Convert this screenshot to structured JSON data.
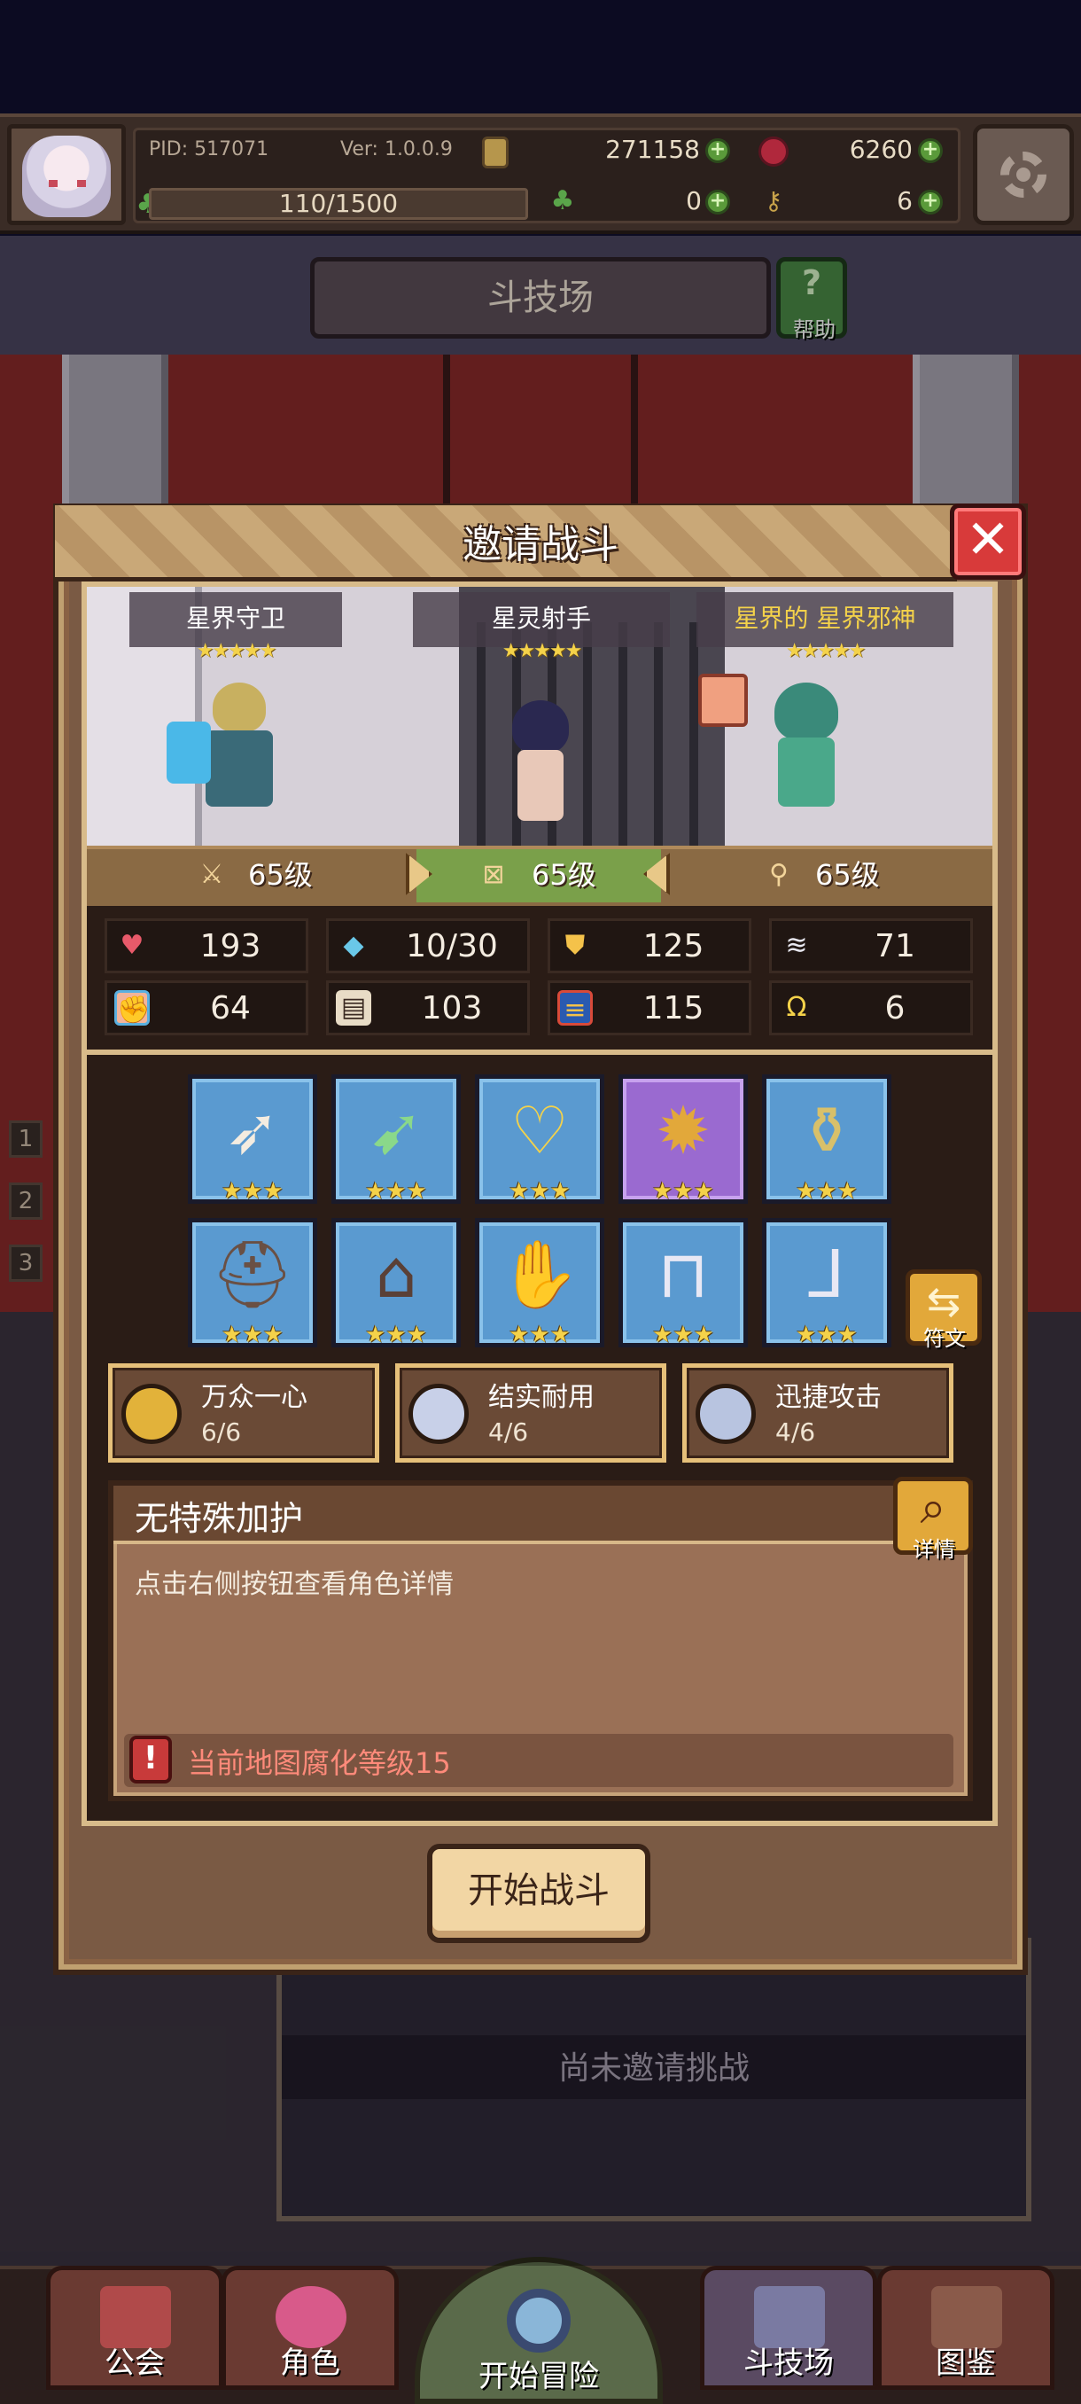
{
  "header": {
    "pid": "PID: 517071",
    "version": "Ver: 1.0.0.9",
    "gold": "271158",
    "gems": "6260",
    "energy": "110/1500",
    "clovers": "0",
    "keys": "6",
    "energy_fraction": 0.0733
  },
  "arena": {
    "title": "斗技场",
    "help_label": "帮助",
    "side_numbers": [
      "1",
      "2",
      "3"
    ],
    "challenge_status": "尚未邀请挑战"
  },
  "modal": {
    "title": "邀请战斗",
    "close_glyph": "✕",
    "heroes": [
      {
        "name": "星界守卫",
        "stars": "★★★★★",
        "level": "65级"
      },
      {
        "name": "星灵射手",
        "stars": "★★★★★",
        "level": "65级"
      },
      {
        "name": "星界的 星界邪神",
        "stars": "★★★★★",
        "level": "65级"
      }
    ],
    "stats": [
      {
        "icon": "heart-icon",
        "glyph": "♥",
        "value": "193",
        "color": "#e85a6a"
      },
      {
        "icon": "mana-drop-icon",
        "glyph": "💧",
        "value": "10/30",
        "color": "#6ac8e8"
      },
      {
        "icon": "shield-icon",
        "glyph": "⛊",
        "value": "125",
        "color": "#f4c24a"
      },
      {
        "icon": "wing-icon",
        "glyph": "≋",
        "value": "71",
        "color": "#e8e8f0"
      },
      {
        "icon": "fist-icon",
        "glyph": "✊",
        "value": "64",
        "color": "#f2b49a"
      },
      {
        "icon": "book-icon",
        "glyph": "▤",
        "value": "103",
        "color": "#e8dcc6"
      },
      {
        "icon": "scroll-icon",
        "glyph": "≡",
        "value": "115",
        "color": "#f4c24a"
      },
      {
        "icon": "horseshoe-icon",
        "glyph": "Ω",
        "value": "6",
        "color": "#f4d24a"
      }
    ],
    "equipment": [
      {
        "name": "bow-icon",
        "glyph": "➶",
        "stars": "★★★",
        "rarity": "blue"
      },
      {
        "name": "arrow-icon",
        "glyph": "➹",
        "stars": "★★★",
        "rarity": "blue"
      },
      {
        "name": "necklace-icon",
        "glyph": "♡",
        "stars": "★★★",
        "rarity": "blue"
      },
      {
        "name": "amulet-icon",
        "glyph": "✹",
        "stars": "★★★",
        "rarity": "purple"
      },
      {
        "name": "ring-icon",
        "glyph": "⚱",
        "stars": "★★★",
        "rarity": "blue"
      },
      {
        "name": "hood-icon",
        "glyph": "⛑",
        "stars": "★★★",
        "rarity": "blue"
      },
      {
        "name": "robe-icon",
        "glyph": "⌂",
        "stars": "★★★",
        "rarity": "blue"
      },
      {
        "name": "gloves-icon",
        "glyph": "✋",
        "stars": "★★★",
        "rarity": "blue"
      },
      {
        "name": "belt-icon",
        "glyph": "⊓",
        "stars": "★★★",
        "rarity": "blue"
      },
      {
        "name": "boots-icon",
        "glyph": "⅃",
        "stars": "★★★",
        "rarity": "blue"
      }
    ],
    "rune_label": "符文",
    "sets": [
      {
        "name": "万众一心",
        "progress": "6/6",
        "color": "#e2b23a"
      },
      {
        "name": "结实耐用",
        "progress": "4/6",
        "color": "#c8d0e8"
      },
      {
        "name": "迅捷攻击",
        "progress": "4/6",
        "color": "#b8c4e0"
      }
    ],
    "blessing": {
      "title": "无特殊加护",
      "description": "点击右侧按钮查看角色详情",
      "detail_label": "详情",
      "warning_glyph": "!",
      "warning": "当前地图腐化等级15"
    },
    "start_button": "开始战斗"
  },
  "nav": {
    "items": [
      "公会",
      "角色",
      "开始冒险",
      "斗技场",
      "图鉴"
    ]
  }
}
